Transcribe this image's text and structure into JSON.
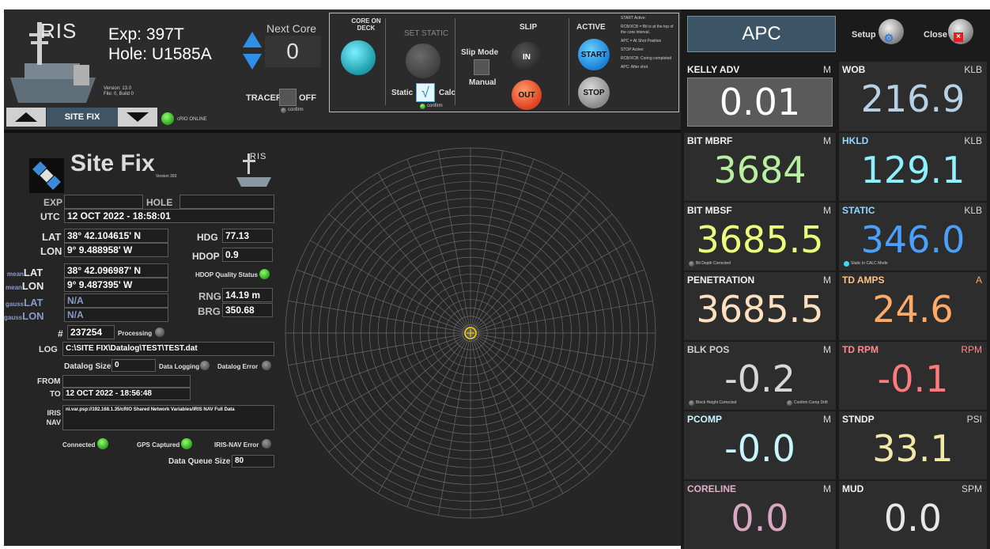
{
  "top_bar": {
    "logo_text": "RIS",
    "exp": "Exp: 397T",
    "hole": "Hole: U1585A",
    "version": "Version: 13.0",
    "file": "File: 0, Build 0",
    "next_core_label": "Next Core",
    "next_core_value": "0",
    "tracer_label": "TRACER",
    "tracer_state": "OFF",
    "tracer_confirm": "confirm",
    "nav_label": "SITE FIX",
    "crio_status": "cRIO ONLINE"
  },
  "controls": {
    "core_on_deck": "CORE ON DECK",
    "set_static": "SET STATIC",
    "slip_mode": "Slip Mode",
    "manual": "Manual",
    "static": "Static",
    "calc": "Calc",
    "static_confirm": "confirm",
    "slip": "SLIP",
    "in": "IN",
    "out": "OUT",
    "active": "ACTIVE",
    "start": "START",
    "stop": "STOP",
    "notes": [
      "START Active:",
      "RCB/XCB = Bit is at the top of the core interval.",
      "APC = At Shot Position",
      "STOP Active:",
      "RCB/XCB: Coring completed",
      "APC: After shot"
    ]
  },
  "header_right": {
    "mode": "APC",
    "setup": "Setup",
    "close": "Close"
  },
  "sitefix": {
    "title": "Site Fix",
    "version": "Version 393",
    "logo_text": "RIS",
    "exp_label": "EXP",
    "hole_label": "HOLE",
    "exp_value": "",
    "hole_value": "",
    "utc_label": "UTC",
    "utc_value": "12 OCT 2022 - 18:58:01",
    "lat_label": "LAT",
    "lat_value": "38° 42.104615' N",
    "lon_label": "LON",
    "lon_value": "9° 9.488958' W",
    "hdg_label": "HDG",
    "hdg_value": "77.13",
    "hdop_label": "HDOP",
    "hdop_value": "0.9",
    "mean_prefix": "mean",
    "meanlat_value": "38° 42.096987' N",
    "meanlon_value": "9° 9.487395' W",
    "hdop_quality": "HDOP Quality Status",
    "gauss_prefix": "gauss",
    "gausslat_value": "N/A",
    "gausslon_value": "N/A",
    "rng_label": "RNG",
    "rng_value": "14.19 m",
    "brg_label": "BRG",
    "brg_value": "350.68",
    "count_label": "#",
    "count_value": "237254",
    "processing": "Processing",
    "log_label": "LOG",
    "log_value": "C:\\SITE FIX\\Datalog\\TEST\\TEST.dat",
    "datalog_size_label": "Datalog Size",
    "datalog_size_value": "0",
    "data_logging": "Data Logging",
    "datalog_error": "Datalog Error",
    "from_label": "FROM",
    "to_label": "TO",
    "from_value": "",
    "to_value": "12 OCT 2022 - 18:56:48",
    "iris_nav_label": "IRIS NAV",
    "iris_nav_value": "ni.var.psp://192.168.1.35/cRIO Shared Network Variables/IRIS NAV Full Data",
    "connected": "Connected",
    "gps_captured": "GPS Captured",
    "iris_nav_error": "IRIS-NAV Error",
    "queue_label": "Data Queue Size",
    "queue_value": "80"
  },
  "tiles": {
    "kelly": {
      "name": "KELLY ADV",
      "unit": "M",
      "value": "0.01"
    },
    "wob": {
      "name": "WOB",
      "unit": "KLB",
      "value": "216.9"
    },
    "bit_mbrf": {
      "name": "BIT MBRF",
      "unit": "M",
      "value": "3684"
    },
    "hkld": {
      "name": "HKLD",
      "unit": "KLB",
      "value": "129.1"
    },
    "bit_mbsf": {
      "name": "BIT MBSF",
      "unit": "M",
      "value": "3685.5",
      "note": "Bit Depth Corrected"
    },
    "static": {
      "name": "STATIC",
      "unit": "KLB",
      "value": "346.0",
      "note": "Static In CALC Mode"
    },
    "penetration": {
      "name": "PENETRATION",
      "unit": "M",
      "value": "3685.5"
    },
    "td_amps": {
      "name": "TD AMPS",
      "unit": "A",
      "value": "24.6"
    },
    "blk_pos": {
      "name": "BLK POS",
      "unit": "M",
      "value": "-0.2",
      "note1": "Block Height Corrected",
      "note2": "Confirm Comp Drift"
    },
    "td_rpm": {
      "name": "TD RPM",
      "unit": "RPM",
      "value": "-0.1"
    },
    "pcomp": {
      "name": "PCOMP",
      "unit": "M",
      "value": "-0.0"
    },
    "stndp": {
      "name": "STNDP",
      "unit": "PSI",
      "value": "33.1"
    },
    "coreline": {
      "name": "CORELINE",
      "unit": "M",
      "value": "0.0"
    },
    "mud": {
      "name": "MUD",
      "unit": "SPM",
      "value": "0.0"
    }
  },
  "colors": {
    "kelly": "#ffffff",
    "wob": "#b8d0e4",
    "bit_mbrf": "#b8f0a0",
    "hkld": "#8ff0ff",
    "bit_mbsf": "#ecff7a",
    "static": "#4aa0ff",
    "penetration": "#ffe0c0",
    "td_amps": "#ffaa66",
    "blk_pos": "#d8d8d8",
    "td_rpm": "#ff7a7a",
    "pcomp": "#c8f6ff",
    "stndp": "#f2e8a8",
    "coreline": "#d8a8c0",
    "mud": "#e8e8e8"
  }
}
